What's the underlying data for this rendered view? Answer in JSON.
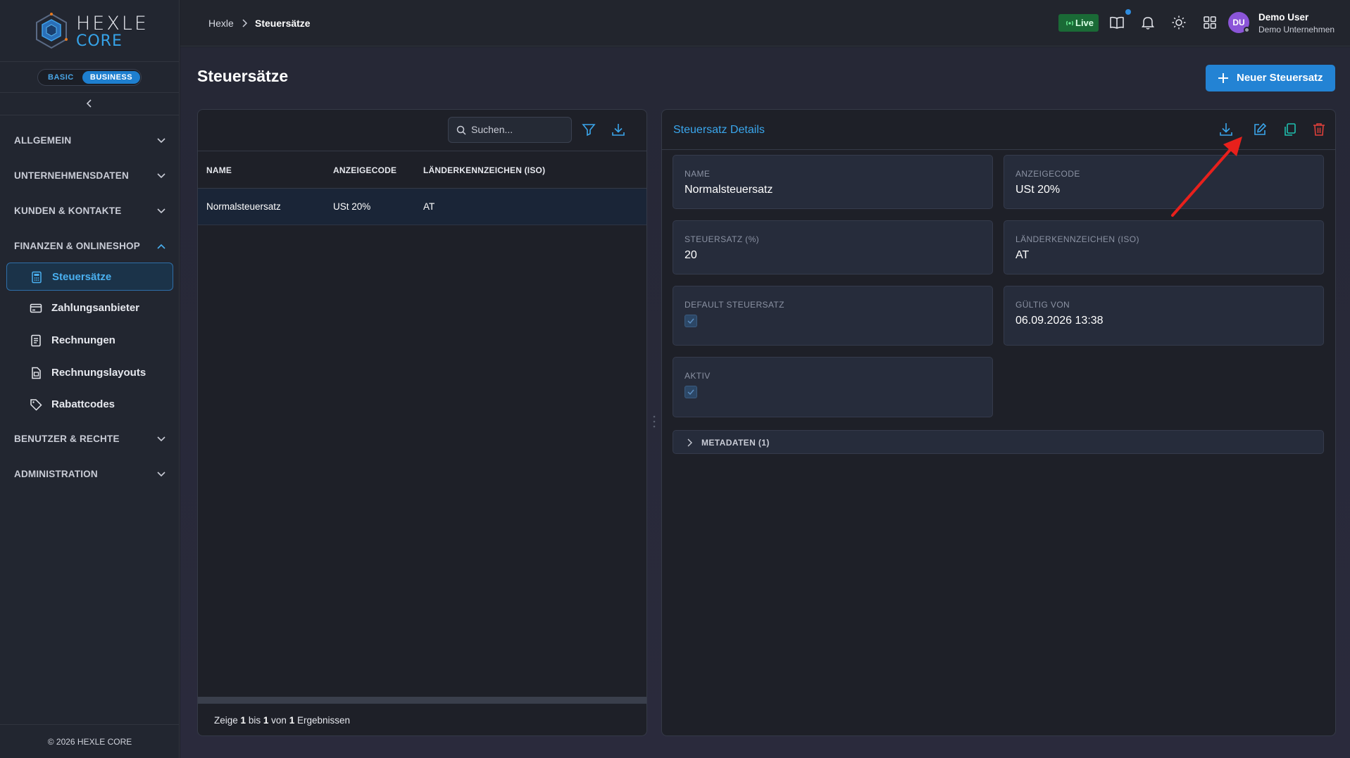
{
  "app": {
    "logo_text_top": "HEXLE",
    "logo_text_bottom": "CORE"
  },
  "plan": {
    "basic": "BASIC",
    "business": "BUSINESS",
    "selected": "BUSINESS"
  },
  "sidebar": {
    "sections": [
      {
        "label": "ALLGEMEIN",
        "expanded": false
      },
      {
        "label": "UNTERNEHMENSDATEN",
        "expanded": false
      },
      {
        "label": "KUNDEN & KONTAKTE",
        "expanded": false
      },
      {
        "label": "FINANZEN & ONLINESHOP",
        "expanded": true
      },
      {
        "label": "BENUTZER & RECHTE",
        "expanded": false
      },
      {
        "label": "ADMINISTRATION",
        "expanded": false
      }
    ],
    "items": [
      {
        "label": "Steuersätze",
        "icon": "calculator-icon",
        "active": true
      },
      {
        "label": "Zahlungsanbieter",
        "icon": "credit-card-icon",
        "active": false
      },
      {
        "label": "Rechnungen",
        "icon": "invoice-icon",
        "active": false
      },
      {
        "label": "Rechnungslayouts",
        "icon": "document-layout-icon",
        "active": false
      },
      {
        "label": "Rabattcodes",
        "icon": "tag-icon",
        "active": false
      }
    ],
    "copyright": "© 2026 HEXLE CORE"
  },
  "topbar": {
    "breadcrumb": [
      "Hexle",
      "Steuersätze"
    ],
    "live_label": "Live",
    "user": {
      "initials": "DU",
      "name": "Demo User",
      "company": "Demo Unternehmen"
    }
  },
  "page": {
    "title": "Steuersätze",
    "new_button": "Neuer Steuersatz"
  },
  "list": {
    "search_placeholder": "Suchen...",
    "columns": [
      "NAME",
      "ANZEIGECODE",
      "LÄNDERKENNZEICHEN (ISO)"
    ],
    "rows": [
      {
        "name": "Normalsteuersatz",
        "code": "USt 20%",
        "iso": "AT"
      }
    ],
    "footer": {
      "prefix": "Zeige",
      "from": "1",
      "mid1": "bis",
      "to": "1",
      "mid2": "von",
      "total": "1",
      "suffix": "Ergebnissen"
    }
  },
  "detail": {
    "title": "Steuersatz Details",
    "fields": {
      "name": {
        "label": "NAME",
        "value": "Normalsteuersatz"
      },
      "code": {
        "label": "ANZEIGECODE",
        "value": "USt 20%"
      },
      "rate": {
        "label": "STEUERSATZ (%)",
        "value": "20"
      },
      "iso": {
        "label": "LÄNDERKENNZEICHEN (ISO)",
        "value": "AT"
      },
      "default": {
        "label": "DEFAULT STEUERSATZ",
        "checked": true
      },
      "valid_from": {
        "label": "GÜLTIG VON",
        "value": "06.09.2026 13:38"
      },
      "active": {
        "label": "AKTIV",
        "checked": true
      }
    },
    "metadata_label": "METADATEN (1)"
  },
  "colors": {
    "accent": "#2383d4",
    "live": "#1a6a36",
    "delete": "#e0403a",
    "annotation_arrow": "#e8201c"
  }
}
